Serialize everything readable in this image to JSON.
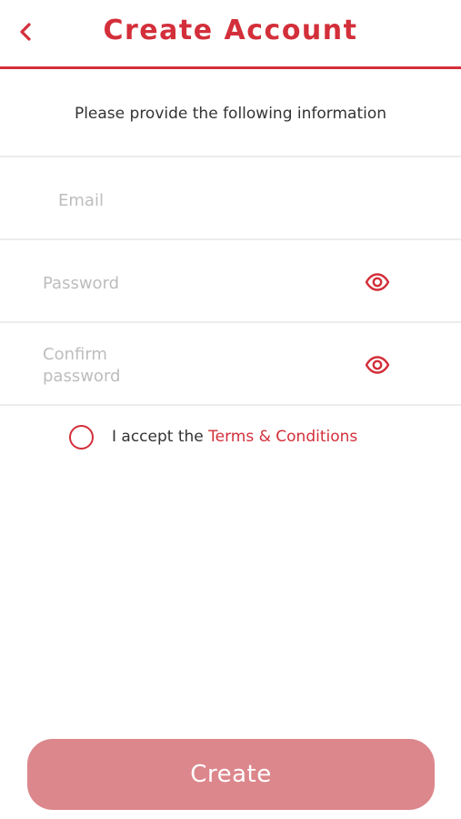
{
  "header": {
    "title": "Create Account",
    "back_icon": "chevron-left-icon"
  },
  "subtitle": "Please provide the following information",
  "form": {
    "email": {
      "placeholder": "Email",
      "value": ""
    },
    "password": {
      "placeholder": "Password",
      "value": "",
      "toggle_icon": "eye-icon"
    },
    "confirm_password": {
      "placeholder_line1": "Confirm",
      "placeholder_line2": "password",
      "value": "",
      "toggle_icon": "eye-icon"
    }
  },
  "terms": {
    "checked": false,
    "prefix": "I accept the ",
    "link": "Terms & Conditions"
  },
  "create_button": {
    "label": "Create"
  },
  "colors": {
    "accent": "#d32f3a",
    "button_disabled": "#dc878c",
    "placeholder": "#bdbdbd",
    "divider": "#ececec"
  }
}
